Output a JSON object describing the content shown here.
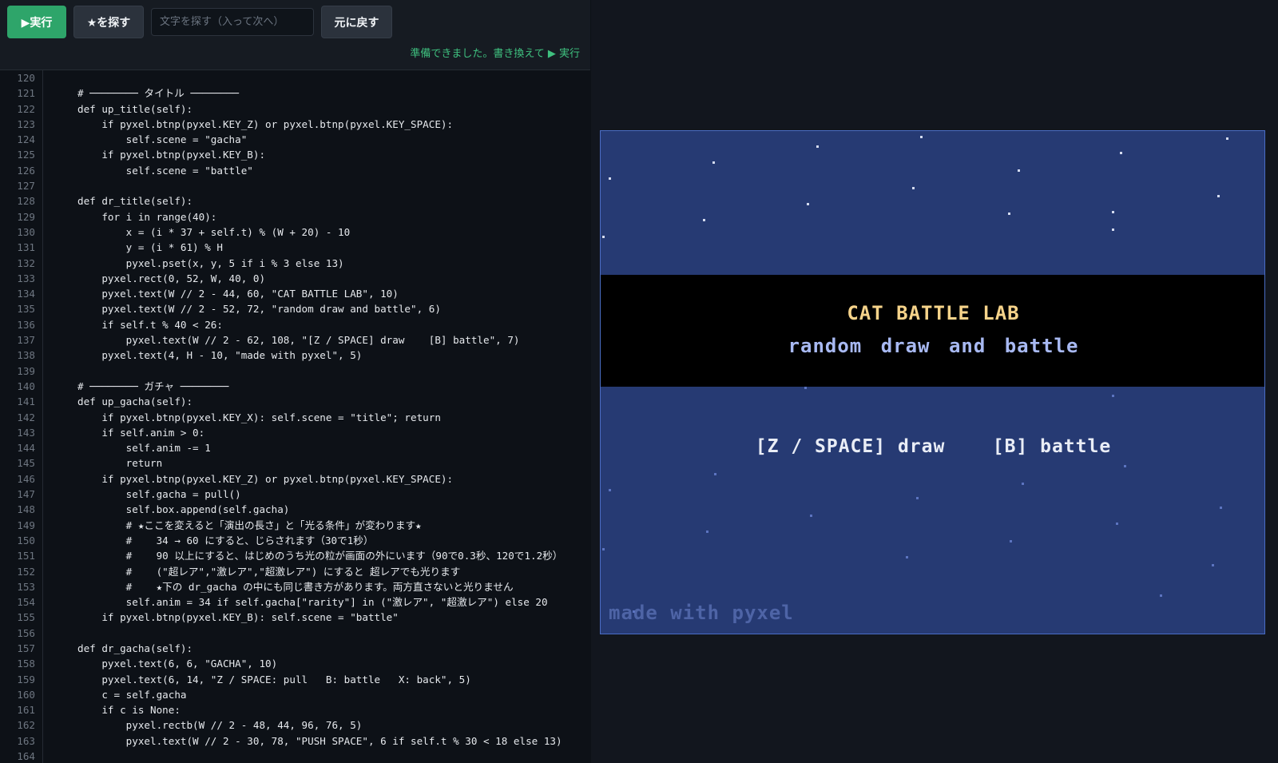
{
  "toolbar": {
    "run_label": "▶実行",
    "find_star_label": "★を探す",
    "search_placeholder": "文字を探す（入って次へ）",
    "undo_label": "元に戻す",
    "status": "準備できました。書き換えて ▶ 実行"
  },
  "editor": {
    "lines": [
      {
        "n": "120",
        "code": ""
      },
      {
        "n": "121",
        "code": "# ──────── タイトル ────────"
      },
      {
        "n": "122",
        "code": "def up_title(self):"
      },
      {
        "n": "123",
        "code": "    if pyxel.btnp(pyxel.KEY_Z) or pyxel.btnp(pyxel.KEY_SPACE):"
      },
      {
        "n": "124",
        "code": "        self.scene = \"gacha\""
      },
      {
        "n": "125",
        "code": "    if pyxel.btnp(pyxel.KEY_B):"
      },
      {
        "n": "126",
        "code": "        self.scene = \"battle\""
      },
      {
        "n": "127",
        "code": ""
      },
      {
        "n": "128",
        "code": "def dr_title(self):"
      },
      {
        "n": "129",
        "code": "    for i in range(40):"
      },
      {
        "n": "130",
        "code": "        x = (i * 37 + self.t) % (W + 20) - 10"
      },
      {
        "n": "131",
        "code": "        y = (i * 61) % H"
      },
      {
        "n": "132",
        "code": "        pyxel.pset(x, y, 5 if i % 3 else 13)"
      },
      {
        "n": "133",
        "code": "    pyxel.rect(0, 52, W, 40, 0)"
      },
      {
        "n": "134",
        "code": "    pyxel.text(W // 2 - 44, 60, \"CAT BATTLE LAB\", 10)"
      },
      {
        "n": "135",
        "code": "    pyxel.text(W // 2 - 52, 72, \"random draw and battle\", 6)"
      },
      {
        "n": "136",
        "code": "    if self.t % 40 < 26:"
      },
      {
        "n": "137",
        "code": "        pyxel.text(W // 2 - 62, 108, \"[Z / SPACE] draw    [B] battle\", 7)"
      },
      {
        "n": "138",
        "code": "    pyxel.text(4, H - 10, \"made with pyxel\", 5)"
      },
      {
        "n": "139",
        "code": ""
      },
      {
        "n": "140",
        "code": "# ──────── ガチャ ────────"
      },
      {
        "n": "141",
        "code": "def up_gacha(self):"
      },
      {
        "n": "142",
        "code": "    if pyxel.btnp(pyxel.KEY_X): self.scene = \"title\"; return"
      },
      {
        "n": "143",
        "code": "    if self.anim > 0:"
      },
      {
        "n": "144",
        "code": "        self.anim -= 1"
      },
      {
        "n": "145",
        "code": "        return"
      },
      {
        "n": "146",
        "code": "    if pyxel.btnp(pyxel.KEY_Z) or pyxel.btnp(pyxel.KEY_SPACE):"
      },
      {
        "n": "147",
        "code": "        self.gacha = pull()"
      },
      {
        "n": "148",
        "code": "        self.box.append(self.gacha)"
      },
      {
        "n": "149",
        "code": "        # ★ここを変えると「演出の長さ」と「光る条件」が変わります★"
      },
      {
        "n": "150",
        "code": "        #    34 → 60 にすると、じらされます（30で1秒）"
      },
      {
        "n": "151",
        "code": "        #    90 以上にすると、はじめのうち光の粒が画面の外にいます（90で0.3秒、120で1.2秒）"
      },
      {
        "n": "152",
        "code": "        #    (\"超レア\",\"激レア\",\"超激レア\") にすると 超レアでも光ります"
      },
      {
        "n": "153",
        "code": "        #    ★下の dr_gacha の中にも同じ書き方があります。両方直さないと光りません"
      },
      {
        "n": "154",
        "code": "        self.anim = 34 if self.gacha[\"rarity\"] in (\"激レア\", \"超激レア\") else 20"
      },
      {
        "n": "155",
        "code": "    if pyxel.btnp(pyxel.KEY_B): self.scene = \"battle\""
      },
      {
        "n": "156",
        "code": ""
      },
      {
        "n": "157",
        "code": "def dr_gacha(self):"
      },
      {
        "n": "158",
        "code": "    pyxel.text(6, 6, \"GACHA\", 10)"
      },
      {
        "n": "159",
        "code": "    pyxel.text(6, 14, \"Z / SPACE: pull   B: battle   X: back\", 5)"
      },
      {
        "n": "160",
        "code": "    c = self.gacha"
      },
      {
        "n": "161",
        "code": "    if c is None:"
      },
      {
        "n": "162",
        "code": "        pyxel.rectb(W // 2 - 48, 44, 96, 76, 5)"
      },
      {
        "n": "163",
        "code": "        pyxel.text(W // 2 - 30, 78, \"PUSH SPACE\", 6 if self.t % 30 < 18 else 13)"
      },
      {
        "n": "164",
        "code": ""
      }
    ]
  },
  "game": {
    "title": "CAT BATTLE LAB",
    "subtitle": "random draw and battle",
    "controls": "[Z / SPACE] draw    [B] battle",
    "footer": "made with pyxel"
  },
  "colors": {
    "run_button": "#2ea56a",
    "status_text": "#3fc07f",
    "game_bg": "#263a73",
    "title_text": "#f6d38a",
    "subtitle_text": "#a8b9f2"
  }
}
